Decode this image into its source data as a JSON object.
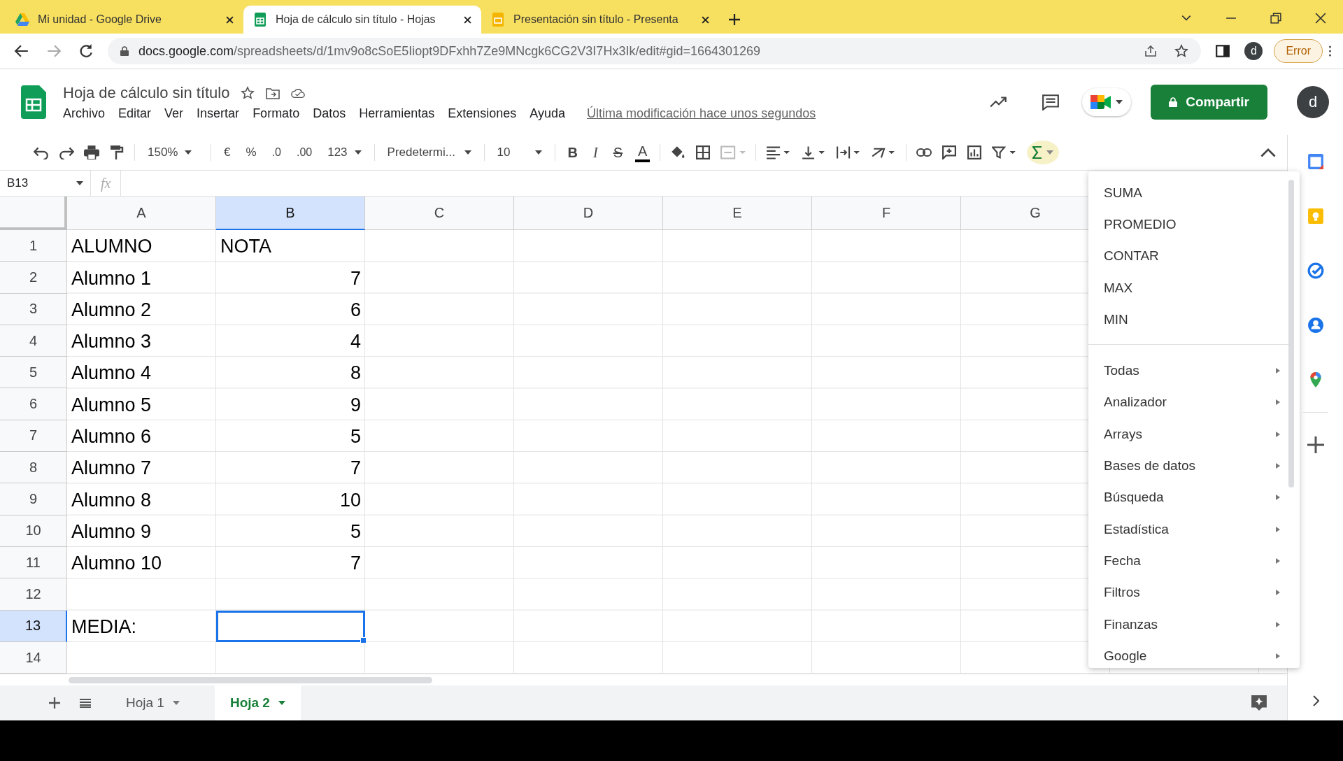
{
  "browser": {
    "tabs": [
      {
        "title": "Mi unidad - Google Drive",
        "kind": "drive",
        "selected": false
      },
      {
        "title": "Hoja de cálculo sin título - Hojas",
        "kind": "sheets",
        "selected": true
      },
      {
        "title": "Presentación sin título - Presenta",
        "kind": "slides",
        "selected": false
      }
    ],
    "url_host": "docs.google.com",
    "url_path": "/spreadsheets/d/1mv9o8cSoE5Iiopt9DFxhh7Ze9MNcgk6CG2V3I7Hx3Ik/edit#gid=1664301269",
    "profile": "d",
    "error_button": "Error"
  },
  "document": {
    "title": "Hoja de cálculo sin título",
    "menus": [
      "Archivo",
      "Editar",
      "Ver",
      "Insertar",
      "Formato",
      "Datos",
      "Herramientas",
      "Extensiones",
      "Ayuda"
    ],
    "last_edit": "Última modificación hace unos segundos",
    "share_button": "Compartir",
    "avatar": "d"
  },
  "toolbar": {
    "zoom": "150%",
    "currency": "€",
    "percent": "%",
    "decimals_less": ".0",
    "decimals_more": ".00",
    "number_format": "123",
    "font": "Predetermi...",
    "font_size": "10",
    "bold": "B",
    "italic": "I",
    "strike": "S",
    "text_color": "A"
  },
  "formula_bar": {
    "name_box": "B13",
    "fx": "fx"
  },
  "columns": [
    {
      "label": "A",
      "selected": false
    },
    {
      "label": "B",
      "selected": true
    },
    {
      "label": "C",
      "selected": false
    },
    {
      "label": "D",
      "selected": false
    },
    {
      "label": "E",
      "selected": false
    },
    {
      "label": "F",
      "selected": false
    },
    {
      "label": "G",
      "selected": false
    }
  ],
  "rows": [
    {
      "number": "1",
      "selected": false,
      "cells": [
        {
          "text": "ALUMNO",
          "kind": "text"
        },
        {
          "text": "NOTA",
          "kind": "text"
        }
      ]
    },
    {
      "number": "2",
      "selected": false,
      "cells": [
        {
          "text": "Alumno 1",
          "kind": "text"
        },
        {
          "text": "7",
          "kind": "number"
        }
      ]
    },
    {
      "number": "3",
      "selected": false,
      "cells": [
        {
          "text": "Alumno 2",
          "kind": "text"
        },
        {
          "text": "6",
          "kind": "number"
        }
      ]
    },
    {
      "number": "4",
      "selected": false,
      "cells": [
        {
          "text": "Alumno 3",
          "kind": "text"
        },
        {
          "text": "4",
          "kind": "number"
        }
      ]
    },
    {
      "number": "5",
      "selected": false,
      "cells": [
        {
          "text": "Alumno 4",
          "kind": "text"
        },
        {
          "text": "8",
          "kind": "number"
        }
      ]
    },
    {
      "number": "6",
      "selected": false,
      "cells": [
        {
          "text": "Alumno 5",
          "kind": "text"
        },
        {
          "text": "9",
          "kind": "number"
        }
      ]
    },
    {
      "number": "7",
      "selected": false,
      "cells": [
        {
          "text": "Alumno 6",
          "kind": "text"
        },
        {
          "text": "5",
          "kind": "number"
        }
      ]
    },
    {
      "number": "8",
      "selected": false,
      "cells": [
        {
          "text": "Alumno 7",
          "kind": "text"
        },
        {
          "text": "7",
          "kind": "number"
        }
      ]
    },
    {
      "number": "9",
      "selected": false,
      "cells": [
        {
          "text": "Alumno 8",
          "kind": "text"
        },
        {
          "text": "10",
          "kind": "number"
        }
      ]
    },
    {
      "number": "10",
      "selected": false,
      "cells": [
        {
          "text": "Alumno 9",
          "kind": "text"
        },
        {
          "text": "5",
          "kind": "number"
        }
      ]
    },
    {
      "number": "11",
      "selected": false,
      "cells": [
        {
          "text": "Alumno 10",
          "kind": "text"
        },
        {
          "text": "7",
          "kind": "number"
        }
      ]
    },
    {
      "number": "12",
      "selected": false,
      "cells": []
    },
    {
      "number": "13",
      "selected": true,
      "cells": [
        {
          "text": "MEDIA:",
          "kind": "text"
        }
      ]
    },
    {
      "number": "14",
      "selected": false,
      "cells": []
    }
  ],
  "function_menu": {
    "functions": [
      "SUMA",
      "PROMEDIO",
      "CONTAR",
      "MAX",
      "MIN"
    ],
    "categories": [
      "Todas",
      "Analizador",
      "Arrays",
      "Bases de datos",
      "Búsqueda",
      "Estadística",
      "Fecha",
      "Filtros",
      "Finanzas",
      "Google"
    ]
  },
  "sheet_tabs": [
    {
      "label": "Hoja 1",
      "selected": false
    },
    {
      "label": "Hoja 2",
      "selected": true
    }
  ]
}
